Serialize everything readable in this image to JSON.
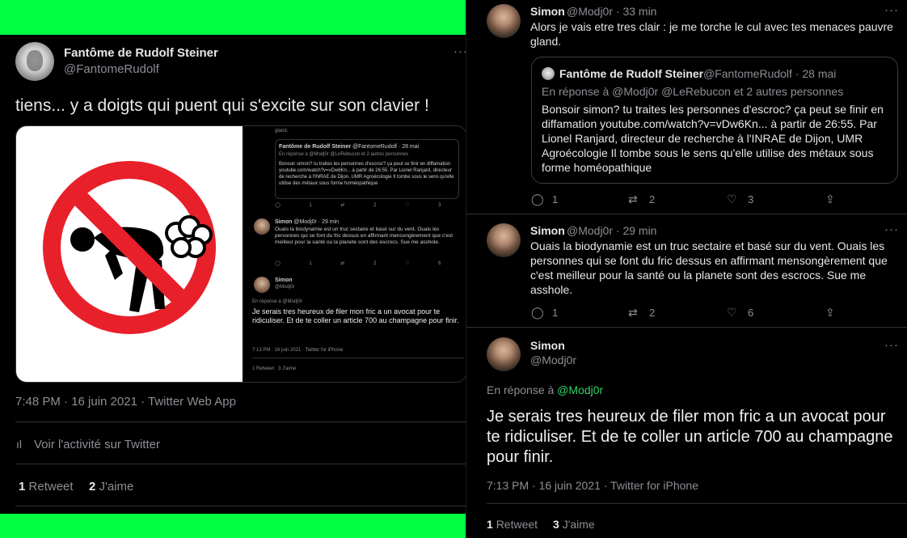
{
  "left_tweet": {
    "author_name": "Fantôme de Rudolf Steiner",
    "author_handle": "@FantomeRudolf",
    "text": "tiens... y a doigts qui puent qui s'excite sur son clavier !",
    "media_screenshot": {
      "top_line": "gland.",
      "quote_name": "Fantôme de Rudolf Steiner",
      "quote_handle_date": "@FantomeRudolf · 28 mai",
      "quote_reply": "En réponse à @Modj0r @LeRebucon  et 2 autres personnes",
      "quote_text": "Bonsoir simon? tu traites les personnes d'escroc? ça peut se finir en diffamation youtube.com/watch?v=vDw6Kn... à partir de 26:55. Par Lionel Ranjard, directeur de recherche à l'INRAE de Dijon, UMR Agroécologie Il tombe sous le sens qu'elle utilise des métaux sous forme homéopathique",
      "row1_counts": [
        "1",
        "2",
        "3"
      ],
      "reply_name": "Simon",
      "reply_handle_time": "@Modj0r · 29 min",
      "reply_text": "Ouais la biodynamie est un truc sectaire et basé sur du vent. Ouais les personnes qui se font du fric dessus en affirmant mensongèrement que c'est meilleur pour la santé ou la planete sont des escrocs. Sue me asshole.",
      "row2_counts": [
        "1",
        "2",
        "6"
      ],
      "main_name": "Simon",
      "main_handle": "@Modj0r",
      "main_reply_to": "En réponse à @Modj0r",
      "main_text": "Je serais tres heureux de filer mon fric a un avocat pour te ridiculiser. Et de te coller un article 700 au champagne pour finir.",
      "main_meta": "7:13 PM · 16 juin 2021 · Twitter for iPhone",
      "main_stats": "1 Retweet   3 J'aime"
    },
    "meta": "7:48 PM · 16 juin 2021 · Twitter Web App",
    "activity": "Voir l'activité sur Twitter",
    "retweets_count": "1",
    "retweets_label": "Retweet",
    "likes_count": "2",
    "likes_label": "J'aime"
  },
  "right_thread": {
    "tweet1": {
      "name": "Simon",
      "handle_time": "@Modj0r · 33 min",
      "text": "Alors je vais etre tres clair : je me torche le cul avec tes menaces pauvre gland.",
      "quote": {
        "name": "Fantôme de Rudolf Steiner",
        "handle_date": "@FantomeRudolf · 28 mai",
        "reply_to": "En réponse à @Modj0r @LeRebucon  et 2 autres personnes",
        "text": "Bonsoir simon? tu traites les personnes d'escroc? ça peut se finir en diffamation youtube.com/watch?v=vDw6Kn... à partir de 26:55. Par Lionel Ranjard, directeur de recherche à l'INRAE de Dijon, UMR Agroécologie Il tombe sous le sens qu'elle utilise des métaux sous forme homéopathique"
      },
      "replies": "1",
      "retweets": "2",
      "likes": "3"
    },
    "tweet2": {
      "name": "Simon",
      "handle_time": "@Modj0r · 29 min",
      "text": "Ouais la biodynamie est un truc sectaire et basé sur du vent. Ouais les personnes qui se font du fric dessus en affirmant mensongèrement que c'est meilleur pour la santé ou la planete sont des escrocs. Sue me asshole.",
      "replies": "1",
      "retweets": "2",
      "likes": "6"
    },
    "tweet3": {
      "name": "Simon",
      "handle": "@Modj0r",
      "reply_prefix": "En réponse à ",
      "reply_mention": "@Modj0r",
      "text": "Je serais tres heureux de filer mon fric a un avocat pour te ridiculiser. Et de te coller un article 700 au champagne pour finir.",
      "meta": "7:13 PM · 16 juin 2021 · Twitter for iPhone",
      "retweets_count": "1",
      "retweets_label": "Retweet",
      "likes_count": "3",
      "likes_label": "J'aime"
    }
  },
  "colors": {
    "accent_green": "#00ff41",
    "link_blue": "#1d9bf0",
    "muted_text": "#8b8f94",
    "no_sign_red": "#e8202a"
  },
  "icons": [
    "more-icon",
    "activity-icon",
    "reply-icon",
    "retweet-icon",
    "like-icon",
    "share-icon",
    "no-fart-sign-icon"
  ]
}
